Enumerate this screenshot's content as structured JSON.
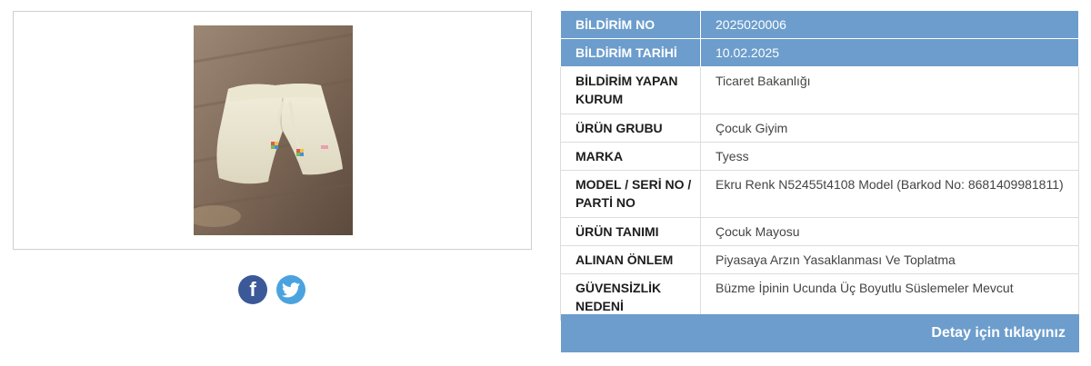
{
  "product_image": {
    "alt": ""
  },
  "share": {
    "facebook_glyph": "f",
    "facebook_icon": "facebook-icon",
    "twitter_icon": "twitter-icon"
  },
  "details": {
    "rows": [
      {
        "label": "BİLDİRİM NO",
        "value": "2025020006"
      },
      {
        "label": "BİLDİRİM TARİHİ",
        "value": "10.02.2025"
      },
      {
        "label": "BİLDİRİM YAPAN KURUM",
        "value": "Ticaret Bakanlığı"
      },
      {
        "label": "ÜRÜN GRUBU",
        "value": "Çocuk Giyim"
      },
      {
        "label": "MARKA",
        "value": "Tyess"
      },
      {
        "label": "MODEL / SERİ NO / PARTİ NO",
        "value": "Ekru Renk N52455t4108 Model (Barkod No: 8681409981811)"
      },
      {
        "label": "ÜRÜN TANIMI",
        "value": "Çocuk Mayosu"
      },
      {
        "label": "ALINAN ÖNLEM",
        "value": "Piyasaya Arzın Yasaklanması Ve Toplatma"
      },
      {
        "label": "GÜVENSİZLİK NEDENİ",
        "value": "Büzme İpinin Ucunda Üç Boyutlu Süslemeler Mevcut"
      }
    ],
    "detail_link": "Detay için tıklayınız"
  },
  "colors": {
    "header_blue": "#6c9dcc",
    "facebook": "#3b5998",
    "twitter": "#4aa3df"
  }
}
